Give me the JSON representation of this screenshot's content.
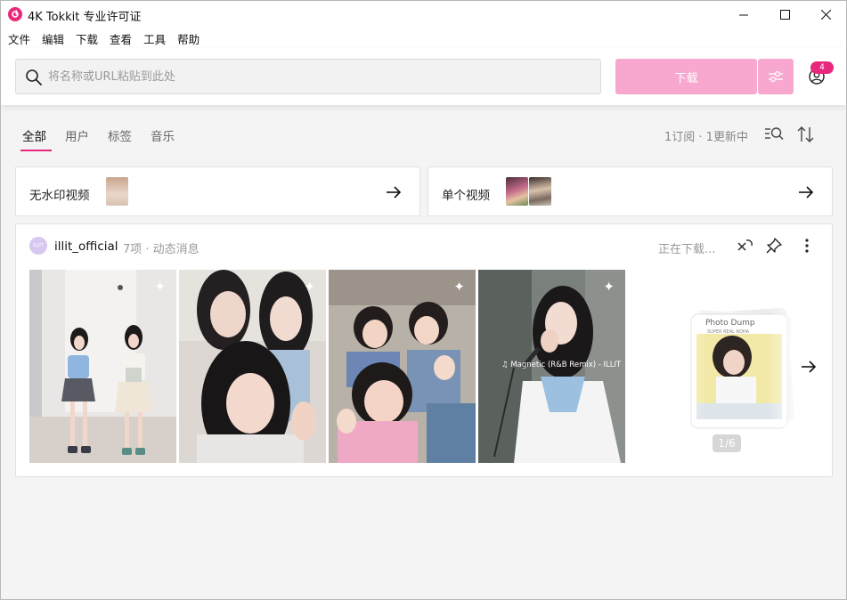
{
  "window": {
    "title": "4K Tokkit 专业许可证"
  },
  "menu": [
    "文件",
    "编辑",
    "下载",
    "查看",
    "工具",
    "帮助"
  ],
  "search": {
    "placeholder": "将名称或URL粘贴到此处",
    "value": ""
  },
  "toolbar": {
    "download_label": "下载",
    "account_badge": "4"
  },
  "tabs": [
    {
      "label": "全部",
      "active": true
    },
    {
      "label": "用户",
      "active": false
    },
    {
      "label": "标签",
      "active": false
    },
    {
      "label": "音乐",
      "active": false
    }
  ],
  "status": {
    "subscriptions": "1订阅 · 1更新中"
  },
  "quick_cards": [
    {
      "label": "无水印视频"
    },
    {
      "label": "单个视频"
    }
  ],
  "feed": {
    "avatar_text": "ILLIT",
    "username": "illit_official",
    "meta": "7项 · 动态消息",
    "status": "正在下载...",
    "overlay_caption": "♫ Magnetic (R&B Remix) - ILLIT",
    "stack_title": "Photo Dump",
    "stack_subtitle": "SUPER REAL ROHA",
    "page_indicator": "1/6"
  },
  "colors": {
    "accent": "#e8287c",
    "button_disabled": "#f8a8cf",
    "background": "#f4f4f4"
  }
}
